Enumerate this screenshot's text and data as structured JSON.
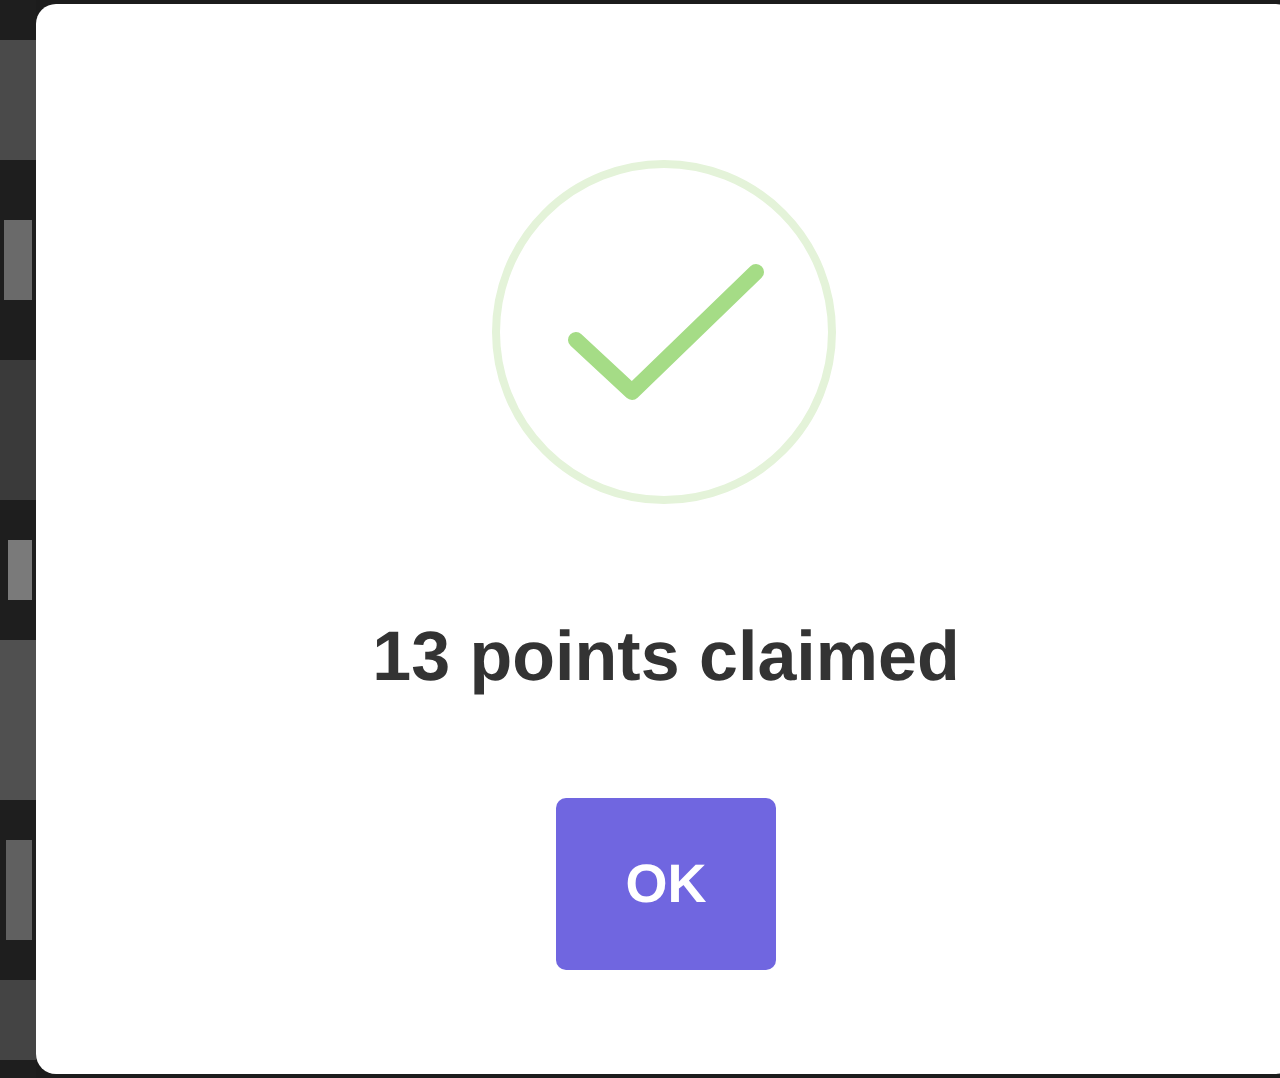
{
  "dialog": {
    "icon": {
      "kind": "success"
    },
    "title": "13 points claimed",
    "buttons": [
      {
        "label": "OK"
      }
    ]
  }
}
